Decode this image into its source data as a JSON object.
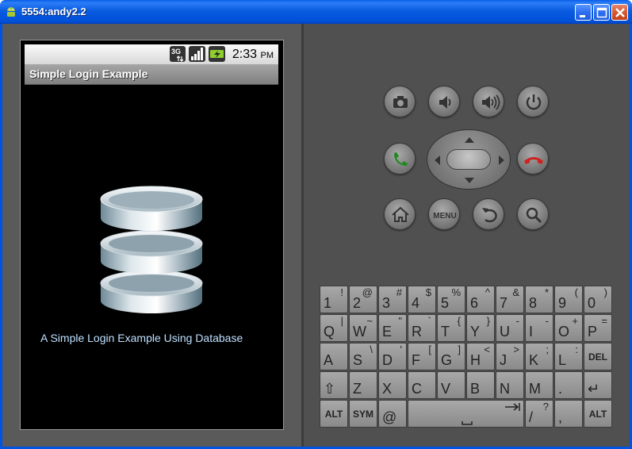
{
  "window": {
    "title": "5554:andy2.2"
  },
  "statusbar": {
    "network": "3G",
    "time": "2:33",
    "ampm": "PM"
  },
  "app": {
    "title": "Simple Login Example",
    "caption": "A Simple Login Example Using Database"
  },
  "buttons": {
    "menu_label": "MENU"
  },
  "keyboard": {
    "row1": [
      [
        "1",
        "!"
      ],
      [
        "2",
        "@"
      ],
      [
        "3",
        "#"
      ],
      [
        "4",
        "$"
      ],
      [
        "5",
        "%"
      ],
      [
        "6",
        "^"
      ],
      [
        "7",
        "&"
      ],
      [
        "8",
        "*"
      ],
      [
        "9",
        "("
      ],
      [
        "0",
        ")"
      ]
    ],
    "row2": [
      [
        "Q",
        "|"
      ],
      [
        "W",
        "~"
      ],
      [
        "E",
        "\""
      ],
      [
        "R",
        "`"
      ],
      [
        "T",
        "{"
      ],
      [
        "Y",
        "}"
      ],
      [
        "U",
        "-"
      ],
      [
        "I",
        "-"
      ],
      [
        "O",
        "+"
      ],
      [
        "P",
        "="
      ]
    ],
    "row3": [
      [
        "A",
        ""
      ],
      [
        "S",
        "\\"
      ],
      [
        "D",
        "'"
      ],
      [
        "F",
        "["
      ],
      [
        "G",
        "]"
      ],
      [
        "H",
        "<"
      ],
      [
        "J",
        ">"
      ],
      [
        "K",
        ";"
      ],
      [
        "L",
        ":"
      ],
      [
        "DEL",
        ""
      ]
    ],
    "row4": [
      [
        "⇧",
        ""
      ],
      [
        "Z",
        ""
      ],
      [
        "X",
        ""
      ],
      [
        "C",
        ""
      ],
      [
        "V",
        ""
      ],
      [
        "B",
        ""
      ],
      [
        "N",
        ""
      ],
      [
        "M",
        ""
      ],
      [
        ".",
        ""
      ],
      [
        "↵",
        ""
      ]
    ],
    "row5": {
      "alt_left": "ALT",
      "sym": "SYM",
      "at": "@",
      "slash": "/",
      "question": "?",
      "comma": ",",
      "alt_right": "ALT"
    }
  },
  "colors": {
    "titlebar": "#0054e3",
    "caption": "#bfe0ff",
    "call": "#1f8a1f",
    "end_call": "#d02020"
  }
}
